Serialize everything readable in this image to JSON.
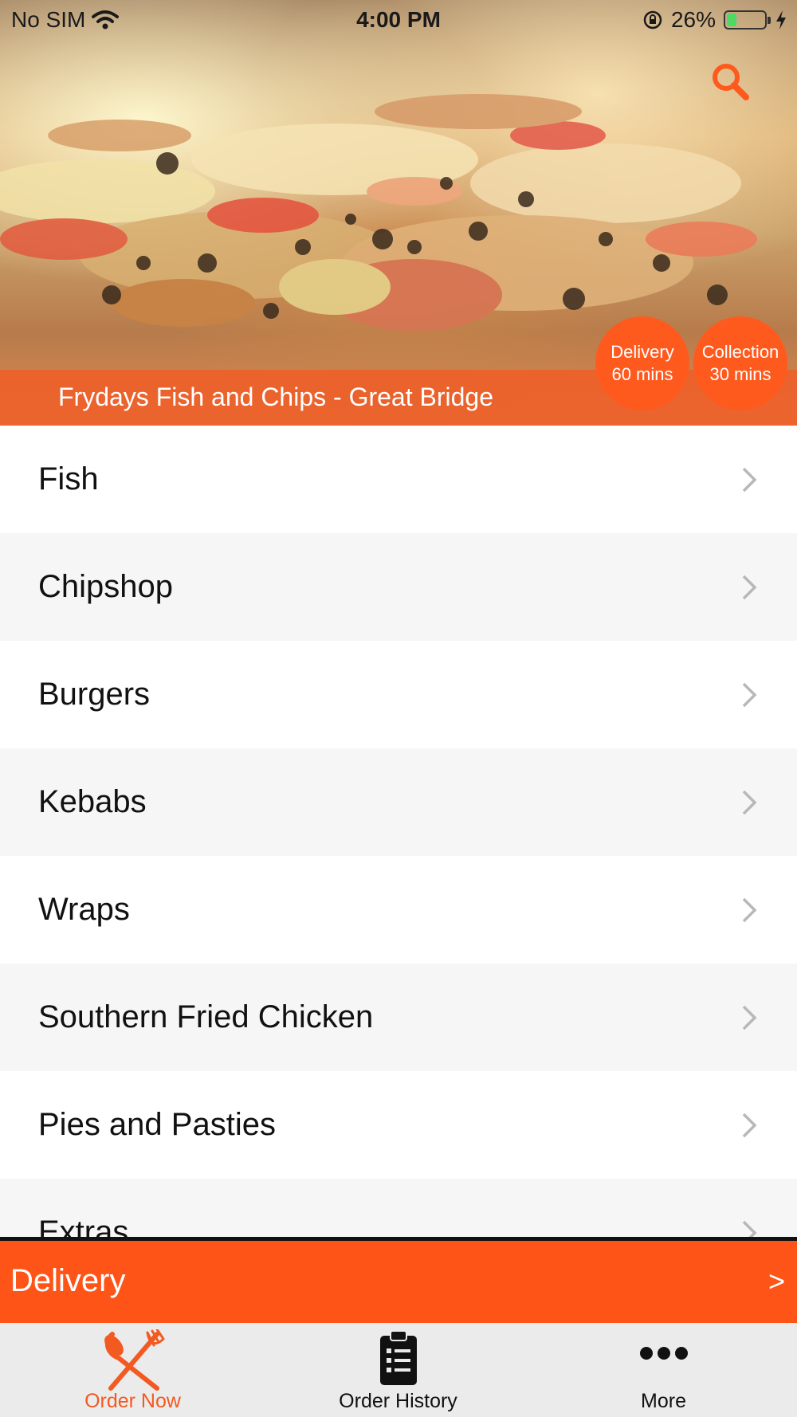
{
  "status_bar": {
    "carrier": "No SIM",
    "time": "4:00 PM",
    "battery_percent": "26%",
    "battery_level": 0.26,
    "icons": [
      "wifi-icon",
      "rotation-lock-icon",
      "battery-icon",
      "charging-icon"
    ]
  },
  "header": {
    "search_icon": "search-icon",
    "restaurant_name": "Frydays Fish and Chips - Great Bridge",
    "delivery_badge": {
      "label": "Delivery",
      "time": "60 mins"
    },
    "collection_badge": {
      "label": "Collection",
      "time": "30 mins"
    }
  },
  "menu": {
    "items": [
      {
        "label": "Fish"
      },
      {
        "label": "Chipshop"
      },
      {
        "label": "Burgers"
      },
      {
        "label": "Kebabs"
      },
      {
        "label": "Wraps"
      },
      {
        "label": "Southern Fried Chicken"
      },
      {
        "label": "Pies and Pasties"
      },
      {
        "label": "Extras"
      }
    ],
    "chevron_icon": "chevron-right-icon"
  },
  "order_bar": {
    "mode_label": "Delivery",
    "arrow": ">"
  },
  "tabbar": {
    "tabs": [
      {
        "label": "Order Now",
        "icon": "fork-knife-icon",
        "active": true
      },
      {
        "label": "Order History",
        "icon": "clipboard-icon",
        "active": false
      },
      {
        "label": "More",
        "icon": "more-dots-icon",
        "active": false
      }
    ]
  },
  "colors": {
    "accent": "#ff5417",
    "badge": "#ff5a1e",
    "title_band": "#ee5e28",
    "row_alt": "#f6f6f6",
    "tab_active": "#f25a22",
    "tabbar_bg": "#ebebeb"
  }
}
